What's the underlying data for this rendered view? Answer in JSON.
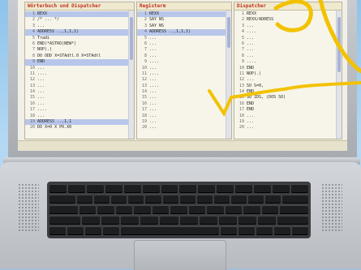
{
  "panes": [
    {
      "title": "Wörterbuch und Dispatcher",
      "lines": [
        {
          "n": "1",
          "t": "REXX",
          "hl": true
        },
        {
          "n": "2",
          "t": "/* ... */"
        },
        {
          "n": "3",
          "t": "..."
        },
        {
          "n": "4",
          "t": "ADDRESS ..,1,1,1)",
          "hl": true
        },
        {
          "n": "5",
          "t": "Tradi"
        },
        {
          "n": "6",
          "t": "END(*ASTRO(NEW*)"
        },
        {
          "n": "7",
          "t": "NOP(.)"
        },
        {
          "n": "8",
          "t": "DO ODD X=STAdtl.0 X=STAdtl"
        },
        {
          "n": "9",
          "t": "END",
          "hl": true
        },
        {
          "n": "10",
          "t": "..."
        },
        {
          "n": "11",
          "t": "...."
        },
        {
          "n": "12",
          "t": "..."
        },
        {
          "n": "13",
          "t": "..."
        },
        {
          "n": "14",
          "t": "..."
        },
        {
          "n": "15",
          "t": "..."
        },
        {
          "n": "16",
          "t": "..."
        },
        {
          "n": "17",
          "t": "...."
        },
        {
          "n": "18",
          "t": "..."
        },
        {
          "n": "19",
          "t": "ADDRESS ..,1,1",
          "hl": true
        },
        {
          "n": "20",
          "t": "DO X=0 X P0.X0"
        }
      ],
      "thumb": 0.35
    },
    {
      "title": "Registerm",
      "lines": [
        {
          "n": "1",
          "t": "REXX",
          "hl": true
        },
        {
          "n": "2",
          "t": "SAY NS"
        },
        {
          "n": "3",
          "t": "SAY NS"
        },
        {
          "n": "4",
          "t": "ADDRESS ..,1,1,1)",
          "hl": true
        },
        {
          "n": "5",
          "t": "..."
        },
        {
          "n": "6",
          "t": "..."
        },
        {
          "n": "7",
          "t": "..."
        },
        {
          "n": "8",
          "t": "..."
        },
        {
          "n": "9",
          "t": "...."
        },
        {
          "n": "10",
          "t": "..."
        },
        {
          "n": "11",
          "t": "...."
        },
        {
          "n": "12",
          "t": "..."
        },
        {
          "n": "13",
          "t": "...."
        },
        {
          "n": "14",
          "t": "..."
        },
        {
          "n": "15",
          "t": "..."
        },
        {
          "n": "16",
          "t": "..."
        },
        {
          "n": "17",
          "t": "..."
        },
        {
          "n": "18",
          "t": "..."
        },
        {
          "n": "19",
          "t": "..."
        },
        {
          "n": "20",
          "t": "..."
        }
      ],
      "thumb": 0.25
    },
    {
      "title": "Dispatcher",
      "lines": [
        {
          "n": "1",
          "t": "REXX"
        },
        {
          "n": "2",
          "t": "REXX/ADRESS"
        },
        {
          "n": "3",
          "t": "..."
        },
        {
          "n": "4",
          "t": "...."
        },
        {
          "n": "5",
          "t": "..."
        },
        {
          "n": "6",
          "t": "..."
        },
        {
          "n": "7",
          "t": "..."
        },
        {
          "n": "8",
          "t": "..."
        },
        {
          "n": "9",
          "t": "...."
        },
        {
          "n": "10",
          "t": "END"
        },
        {
          "n": "11",
          "t": "NOP(.)"
        },
        {
          "n": "12",
          "t": "..."
        },
        {
          "n": "13",
          "t": "SO S=0,"
        },
        {
          "n": "14",
          "t": "END"
        },
        {
          "n": "15",
          "t": "SO IDS, (DOS SO)"
        },
        {
          "n": "16",
          "t": "END"
        },
        {
          "n": "17",
          "t": "END"
        },
        {
          "n": "18",
          "t": "..."
        },
        {
          "n": "19",
          "t": "..."
        },
        {
          "n": "20",
          "t": "..."
        }
      ],
      "thumb": 0.45
    }
  ],
  "colors": {
    "title_text": "#c0301f",
    "highlight": "#b8c6ea",
    "annotation": "#f2c200"
  }
}
